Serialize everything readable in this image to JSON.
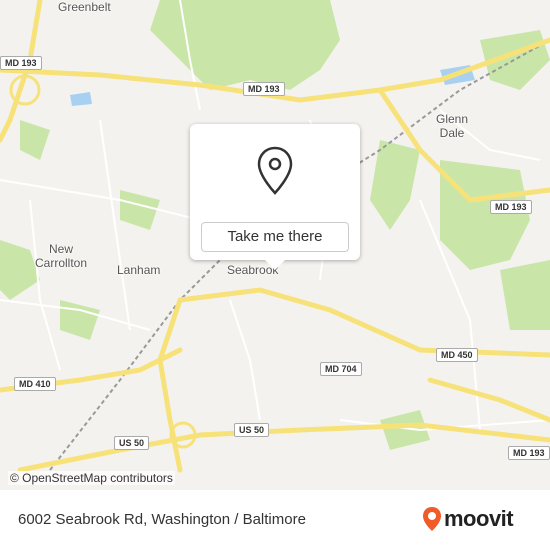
{
  "map": {
    "place_labels": [
      {
        "id": "greenbelt",
        "text": "Greenbelt"
      },
      {
        "id": "glenn-dale",
        "text": "Glenn\nDale"
      },
      {
        "id": "new-carrollton",
        "text": "New\nCarrollton"
      },
      {
        "id": "lanham",
        "text": "Lanham"
      },
      {
        "id": "seabrook",
        "text": "Seabrook"
      }
    ],
    "road_shields": [
      {
        "id": "md193-topleft",
        "text": "MD 193"
      },
      {
        "id": "md193-top",
        "text": "MD 193"
      },
      {
        "id": "md193-right",
        "text": "MD 193"
      },
      {
        "id": "md193-bottomright",
        "text": "MD 193"
      },
      {
        "id": "md704",
        "text": "MD 704"
      },
      {
        "id": "md450",
        "text": "MD 450"
      },
      {
        "id": "md410",
        "text": "MD 410"
      },
      {
        "id": "us50-left",
        "text": "US 50"
      },
      {
        "id": "us50-center",
        "text": "US 50"
      }
    ],
    "attribution": "© OpenStreetMap contributors",
    "colors": {
      "background": "#f4f2ee",
      "park": "#c9e6a8",
      "major_road": "#f7e27a",
      "water": "#a8d0f0",
      "brand": "#f15a29"
    }
  },
  "popup": {
    "pin_icon": "location-pin-icon",
    "button_label": "Take me there"
  },
  "footer": {
    "address": "6002 Seabrook Rd, Washington / Baltimore",
    "logo_text": "moovit",
    "logo_icon": "moovit-pin-icon"
  }
}
